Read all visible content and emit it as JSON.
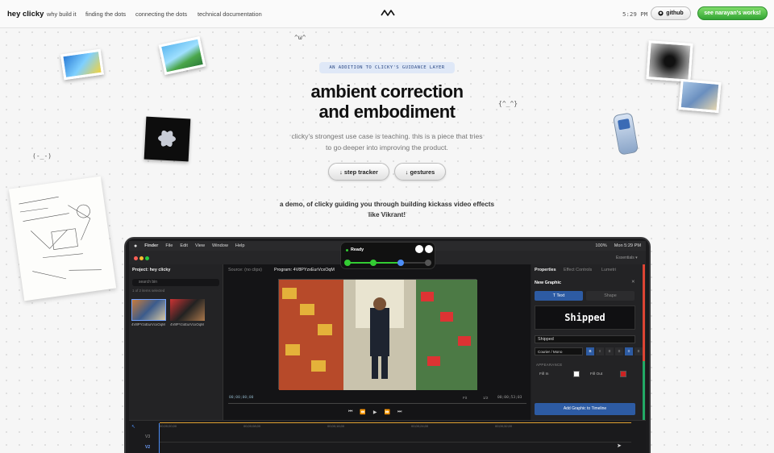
{
  "nav": {
    "brand": "hey clicky",
    "links": [
      "why build it",
      "finding the dots",
      "connecting the dots",
      "technical documentation"
    ],
    "clock": "5:29 PM",
    "github_label": "github",
    "works_label": "see narayan's works!"
  },
  "hero": {
    "eyebrow": "AN ADDITION TO CLICKY'S GUIDANCE LAYER",
    "title_line1": "ambient correction",
    "title_line2": "and embodiment",
    "subtitle": "clicky's strongest use case is teaching. this is a piece that tries to go deeper into improving the product.",
    "btn_step": "↓ step tracker",
    "btn_gestures": "↓ gestures",
    "demo_text": "a demo, of clicky guiding you through building kickass video effects like Vikrant!"
  },
  "kaomoji": [
    "^ω^",
    "{^_^}",
    "(-_-)"
  ],
  "mac": {
    "menu": [
      "Finder",
      "File",
      "Edit",
      "View",
      "Window",
      "Help"
    ],
    "battery": "100%",
    "time": "Mon 5:29 PM",
    "workspace": "Essentials ▾"
  },
  "overlay": {
    "status": "Ready"
  },
  "editor": {
    "project_title": "Project: hey clicky",
    "search_placeholder": "search bin",
    "items_count": "1 of 2 items selected",
    "clip_names": [
      "4V8PYzxEurVcxOqM",
      "4V8PYzxEurVcxOqM"
    ],
    "source_label": "Source: (no clips)",
    "program_label": "Program: 4V8PYzxEurVcxOqM",
    "timecode_left": "00;00;00;00",
    "fit_label": "Fit",
    "scale_label": "1/2",
    "timecode_right": "00;00;53;03",
    "tabs": [
      "Properties",
      "Effect Controls",
      "Lumetri"
    ],
    "new_graphic": "New Graphic",
    "tab_text": "T Text",
    "tab_shape": "Shape",
    "preview_text": "Shipped",
    "text_value": "Shipped",
    "font_value": "Courier / Mono",
    "style_buttons": [
      "B",
      "I",
      "≡",
      "≡",
      "≡",
      "≡"
    ],
    "appearance_label": "APPEARANCE",
    "fill_in": "Fill In",
    "fill_out": "Fill Out",
    "add_button": "Add Graphic to Timeline",
    "timeline_marks": [
      "00;00;00;00",
      "00;00;08;00",
      "00;00;16;00",
      "00;00;24;00",
      "00;00;32;00"
    ],
    "tracks": [
      "V3",
      "V2"
    ]
  },
  "colors": {
    "accent_green": "#34a534",
    "eyebrow_bg": "#dfe8f7",
    "fill_in": "#ffffff",
    "fill_out": "#cc2222",
    "panel_accent": "#2d5ba3"
  }
}
